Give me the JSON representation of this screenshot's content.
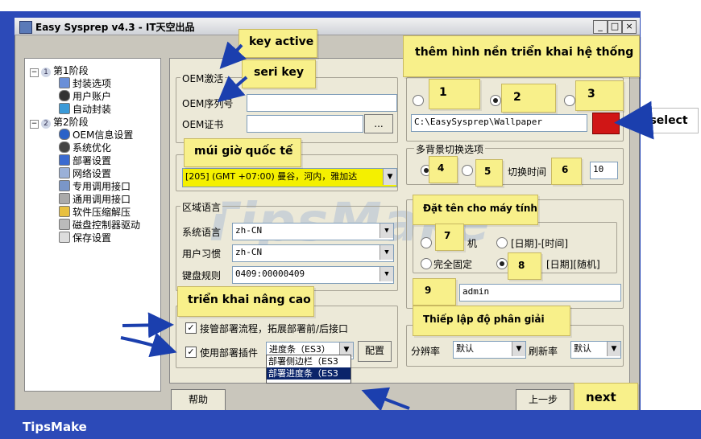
{
  "footer": {
    "brand": "TipsMake"
  },
  "window": {
    "title": "Easy Sysprep v4.3 - IT天空出品",
    "min_label": "_",
    "max_label": "□",
    "close_label": "×"
  },
  "tree": {
    "stage1": {
      "step": "1",
      "label": "第1阶段",
      "children": [
        "封装选项",
        "用户账户",
        "自动封装"
      ]
    },
    "stage2": {
      "step": "2",
      "label": "第2阶段",
      "children": [
        "OEM信息设置",
        "系统优化",
        "部署设置",
        "网络设置",
        "专用调用接口",
        "通用调用接口",
        "软件压缩解压",
        "磁盘控制器驱动",
        "保存设置"
      ]
    }
  },
  "oem": {
    "group_label": "OEM激活",
    "serial_label": "OEM序列号",
    "serial_value": "",
    "cert_label": "OEM证书",
    "cert_value": "",
    "browse_label": "..."
  },
  "timezone": {
    "value": "[205] (GMT +07:00) 曼谷，河内，雅加达"
  },
  "region": {
    "group_label": "区域语言",
    "sys_lang_label": "系统语言",
    "sys_lang_value": "zh-CN",
    "user_lang_label": "用户习惯",
    "user_lang_value": "zh-CN",
    "keyboard_label": "键盘规则",
    "keyboard_value": "0409:00000409"
  },
  "wallpaper": {
    "path": "C:\\EasySysprep\\Wallpaper"
  },
  "multi_bg": {
    "group_label": "多背景切换选项",
    "interval_label": "切换时间",
    "interval_value": "10"
  },
  "computer_name": {
    "opt_suffix": "机",
    "opt_datetime": "[日期]-[时间]",
    "opt_fixed": "完全固定",
    "opt_daterand": "[日期][随机]",
    "name_value": "admin"
  },
  "resolution": {
    "res_label": "分辨率",
    "res_value": "默认",
    "refresh_label": "刷新率",
    "refresh_value": "默认"
  },
  "advanced": {
    "chk1_label": "接管部署流程，拓展部署前/后接口",
    "chk2_label": "使用部署插件",
    "plugin_value": "进度条（ES3）",
    "config_label": "配置",
    "plugin_options": [
      "部署侧边栏（ES3",
      "部署进度条（ES3"
    ]
  },
  "bottom": {
    "help_label": "帮助",
    "prev_label": "上一步"
  },
  "annotations": {
    "key_active": "key active",
    "seri_key": "seri key",
    "them_hinh_nen": "thêm hình nền triển khai hệ thống",
    "n1": "1",
    "n2": "2",
    "n3": "3",
    "select": "select",
    "mui_gio": "múi giờ quốc tế",
    "n4": "4",
    "n5": "5",
    "n6": "6",
    "dat_ten": "Đặt tên cho máy tính",
    "n7": "7",
    "n8": "8",
    "n9": "9",
    "trien_khai": "triển khai nâng cao",
    "thiet_lap": "Thiếp lập độ phân giải",
    "next": "next"
  },
  "watermark": "TipsMake",
  "colors": {
    "background": "#2c4ab8",
    "note": "#f8f08a",
    "select_red": "#d01616",
    "timezone_highlight": "#f4f000"
  }
}
